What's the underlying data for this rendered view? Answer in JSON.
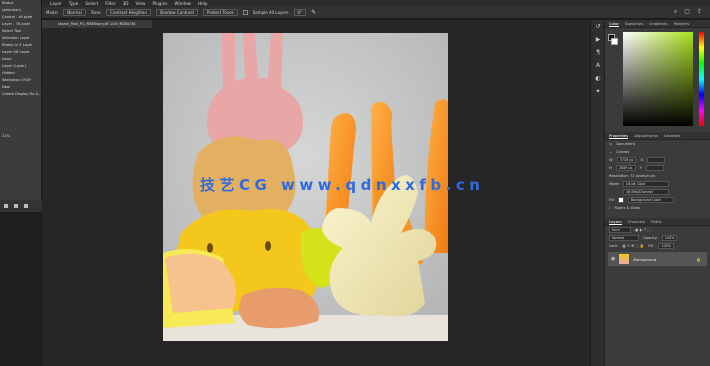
{
  "menu": [
    "Layer",
    "Type",
    "Select",
    "Filter",
    "3D",
    "View",
    "Plugins",
    "Window",
    "Help"
  ],
  "options": {
    "mode_label": "Mode:",
    "mode_value": "Normal",
    "tone_label": "Tone:",
    "btn_contrast": "Contrast Heighten",
    "btn_shadows": "Shadow Contrast",
    "btn_auto": "Protect Tones",
    "sample_all": "Sample All Layers",
    "angle": "0°"
  },
  "doc_tab": "stone_Teal_P1_RREStory.tif  100  (RGB/16)",
  "left_panel": [
    "Status",
    "(selection)",
    "Control - all pixel",
    "Layer - 76 pixel",
    "Select Tool",
    "Selection Layer",
    "Stamp in 5 Layer",
    "Layer Off Layer",
    "Level",
    "Layer (Layer)",
    "Hidden",
    "Workshop / RGP",
    "New",
    "Create Display Fix A...",
    "",
    "",
    "",
    "",
    "",
    "21%"
  ],
  "watermark": "技艺CG  www.qdnxxfb.cn",
  "color_tabs": [
    "Color",
    "Swatches",
    "Gradients",
    "Patterns"
  ],
  "props_tabs": [
    "Properties",
    "Adjustments",
    "Libraries"
  ],
  "props": {
    "doc_label": "Document",
    "canvas_label": "Canvas",
    "w_label": "W",
    "w_value": "3716 px",
    "h_label": "H",
    "h_value": "2849 px",
    "x_label": "X",
    "y_label": "Y",
    "resolution": "Resolution: 72 pixels/inch",
    "mode_label": "Mode",
    "mode_value": "16-bit Color",
    "depth_value": "16 Bits/Channel",
    "fill_label": "Fill",
    "fill_value": "Background Color",
    "rulers": "Rulers & Grids"
  },
  "layers_tabs": [
    "Layers",
    "Channels",
    "Paths"
  ],
  "layers": {
    "kind": "Kind",
    "blend": "Normal",
    "opacity_label": "Opacity:",
    "opacity": "100%",
    "lock_label": "Lock:",
    "fill_label": "Fill:",
    "fill": "100%",
    "layer_name": "Background"
  },
  "colors": {
    "panel": "#3b3b3b",
    "accent": "#1473e6",
    "watermark": "#2e6be0"
  }
}
